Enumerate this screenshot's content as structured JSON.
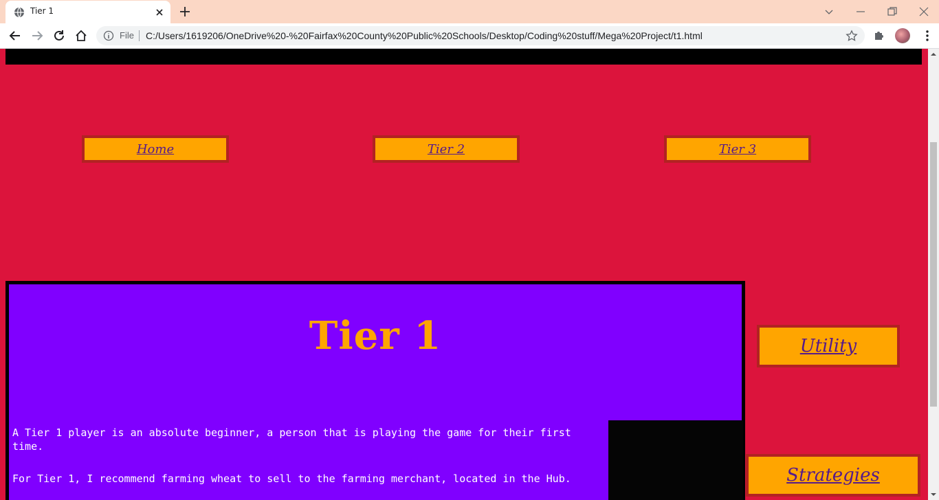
{
  "browser": {
    "tab_title": "Tier 1",
    "file_label": "File",
    "url": "C:/Users/1619206/OneDrive%20-%20Fairfax%20County%20Public%20Schools/Desktop/Coding%20stuff/Mega%20Project/t1.html"
  },
  "nav": {
    "home": "Home",
    "tier2": "Tier 2",
    "tier3": "Tier 3"
  },
  "content": {
    "title": "Tier 1",
    "paragraph1": "A Tier 1 player is an absolute beginner, a person that is playing the game for their first time.",
    "paragraph2": "For Tier 1, I recommend farming wheat to sell to the farming merchant, located in the Hub."
  },
  "side": {
    "utility": "Utility",
    "strategies": "Strategies"
  },
  "colors": {
    "page_bg": "#dc143c",
    "content_bg": "#8000ff",
    "button_bg": "#ffa500",
    "button_border": "#b22222",
    "link": "#551a8b"
  },
  "icons": {
    "favicon": "globe-icon",
    "tab_close": "close-icon",
    "new_tab": "plus-icon",
    "back": "back-arrow-icon",
    "forward": "forward-arrow-icon",
    "reload": "reload-icon",
    "home": "home-icon",
    "info": "info-icon",
    "bookmark": "star-icon",
    "extensions": "puzzle-icon",
    "menu": "kebab-menu-icon"
  }
}
